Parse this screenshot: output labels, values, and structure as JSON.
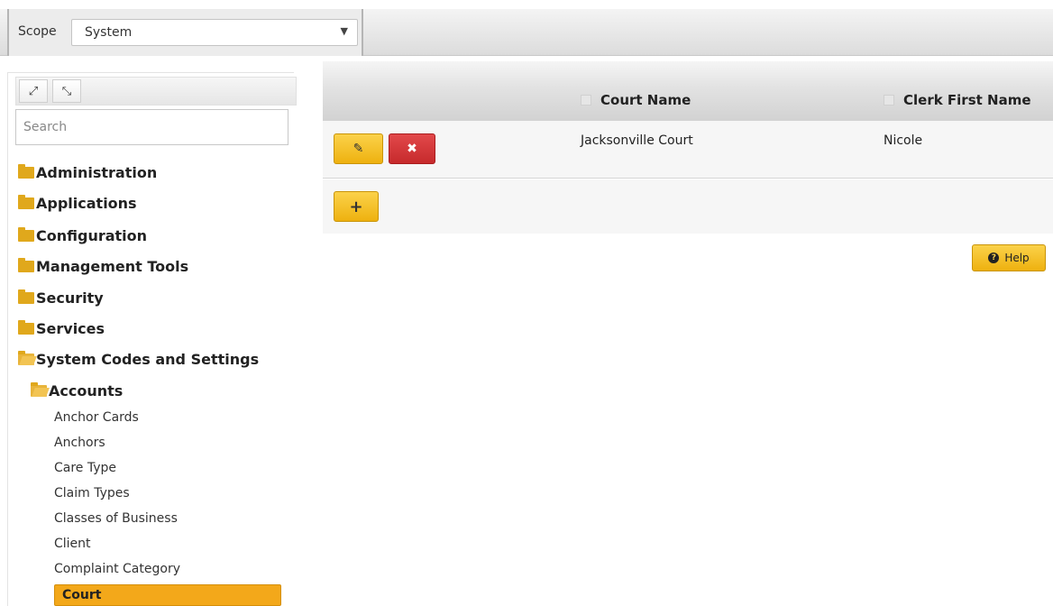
{
  "scope": {
    "label": "Scope",
    "value": "System"
  },
  "tree": {
    "search_placeholder": "Search",
    "folders": [
      {
        "label": "Administration"
      },
      {
        "label": "Applications"
      },
      {
        "label": "Configuration"
      },
      {
        "label": "Management Tools"
      },
      {
        "label": "Security"
      },
      {
        "label": "Services"
      },
      {
        "label": "System Codes and Settings",
        "expanded": true
      }
    ],
    "subfolder": {
      "label": "Accounts",
      "expanded": true
    },
    "items": [
      {
        "label": "Anchor Cards"
      },
      {
        "label": "Anchors"
      },
      {
        "label": "Care Type"
      },
      {
        "label": "Claim Types"
      },
      {
        "label": "Classes of Business"
      },
      {
        "label": "Client"
      },
      {
        "label": "Complaint Category"
      },
      {
        "label": "Court",
        "selected": true
      }
    ]
  },
  "grid": {
    "columns": [
      "Court Name",
      "Clerk First Name"
    ],
    "rows": [
      {
        "court_name": "Jacksonville Court",
        "clerk_first_name": "Nicole"
      }
    ],
    "add_label": "+"
  },
  "help": {
    "label": "Help"
  },
  "colors": {
    "accent_yellow": "#f3a81a",
    "delete_red": "#d13a3c",
    "folder": "#e0a81c"
  }
}
